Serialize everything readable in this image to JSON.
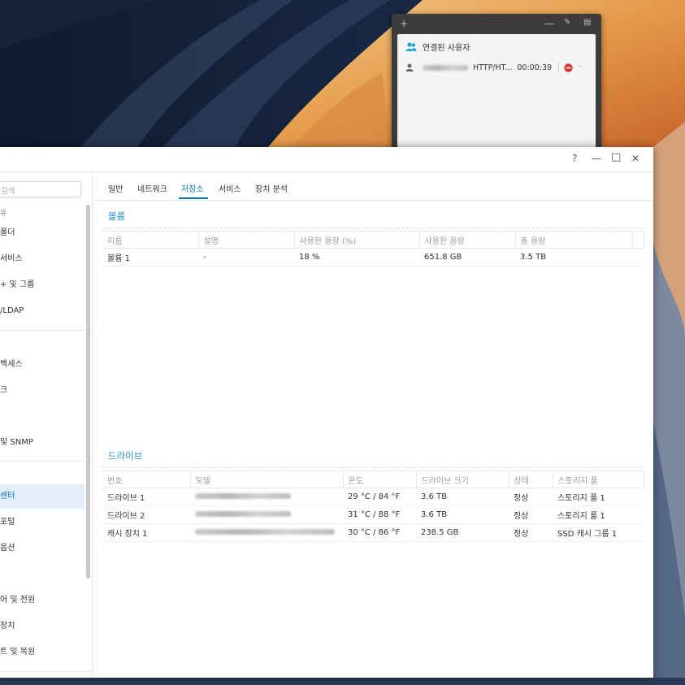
{
  "widget": {
    "title": "연결된 사용자",
    "user": {
      "protocol": "HTTP/HT...",
      "duration": "00:00:39"
    }
  },
  "window": {
    "help": "?",
    "minimize": "—",
    "maximize": "□",
    "close": "✕"
  },
  "sidebar": {
    "search_placeholder": "검색",
    "items": [
      {
        "label": "유"
      },
      {
        "label": "폴더"
      },
      {
        "label": "서비스"
      },
      {
        "label": "+ 및 그룹"
      },
      {
        "label": "/LDAP"
      },
      {
        "label": "백세스"
      },
      {
        "label": "크"
      },
      {
        "label": "및 SNMP"
      },
      {
        "label": "센터"
      },
      {
        "label": "포털"
      },
      {
        "label": "옵션"
      },
      {
        "label": "어 및 전원"
      },
      {
        "label": "장치"
      },
      {
        "label": "트 및 복원"
      }
    ]
  },
  "tabs": [
    {
      "label": "일반"
    },
    {
      "label": "네트워크"
    },
    {
      "label": "저장소"
    },
    {
      "label": "서비스"
    },
    {
      "label": "장치 분석"
    }
  ],
  "volume": {
    "title": "볼륨",
    "columns": [
      "이름",
      "설명",
      "사용한 용량 (%)",
      "사용한 용량",
      "총 용량"
    ],
    "rows": [
      [
        "볼륨 1",
        "-",
        "18 %",
        "651.8 GB",
        "3.5 TB"
      ]
    ]
  },
  "drives": {
    "title": "드라이브",
    "columns": [
      "번호",
      "모델",
      "온도",
      "드라이브 크기",
      "상태",
      "스토리지 풀"
    ],
    "rows": [
      [
        "드라이브 1",
        "",
        "29 °C / 84 °F",
        "3.6 TB",
        "정상",
        "스토리지 풀 1"
      ],
      [
        "드라이브 2",
        "",
        "31 °C / 88 °F",
        "3.6 TB",
        "정상",
        "스토리지 풀 1"
      ],
      [
        "캐시 장치 1",
        "",
        "30 °C / 86 °F",
        "238.5 GB",
        "정상",
        "SSD 캐시 그룹 1"
      ]
    ]
  },
  "colors": {
    "accent": "#0a6fbd",
    "section_title": "#2a8fcf",
    "status_ok": "#2e9e2e"
  }
}
